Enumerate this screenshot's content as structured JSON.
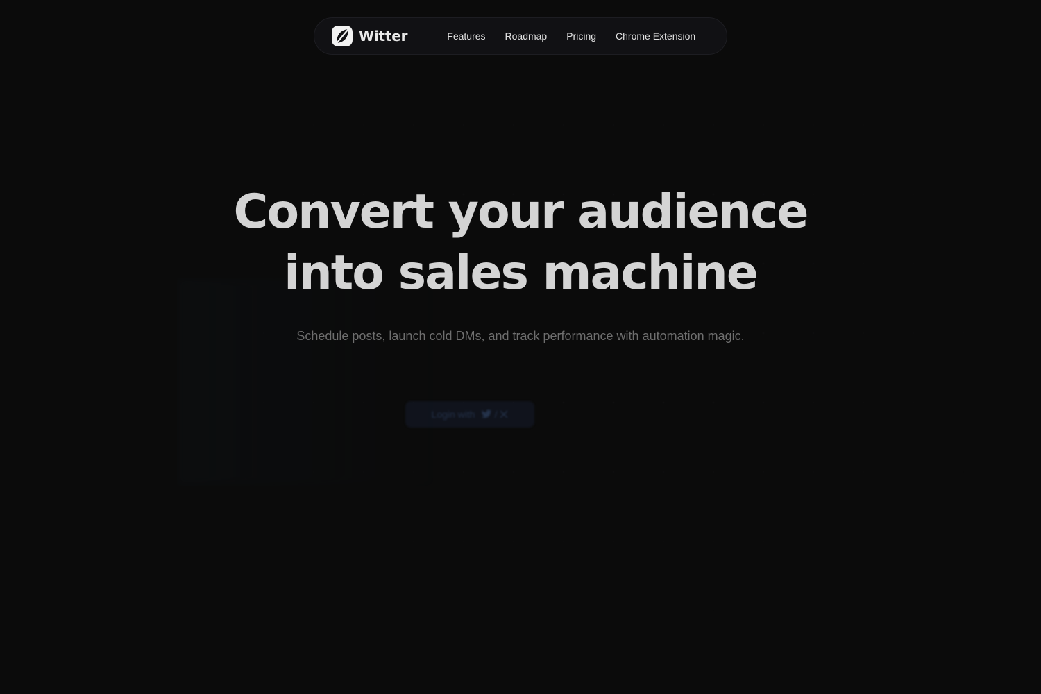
{
  "navbar": {
    "brand_name": "Witter",
    "links": [
      {
        "label": "Features"
      },
      {
        "label": "Roadmap"
      },
      {
        "label": "Pricing"
      },
      {
        "label": "Chrome Extension"
      }
    ]
  },
  "hero": {
    "title_line_1": "Convert your audience",
    "title_line_2": "into sales machine",
    "subtitle": "Schedule posts, launch cold DMs, and track performance with automation magic."
  },
  "cta": {
    "label": "Login with",
    "icons": [
      "bird-icon",
      "slash",
      "x-logo-icon"
    ]
  },
  "colors": {
    "background": "#0b0b0b",
    "navbar_bg": "#111114",
    "title": "#d4d4d4",
    "subtitle": "#6e6e6e",
    "nav_text": "#e2e2e2"
  }
}
